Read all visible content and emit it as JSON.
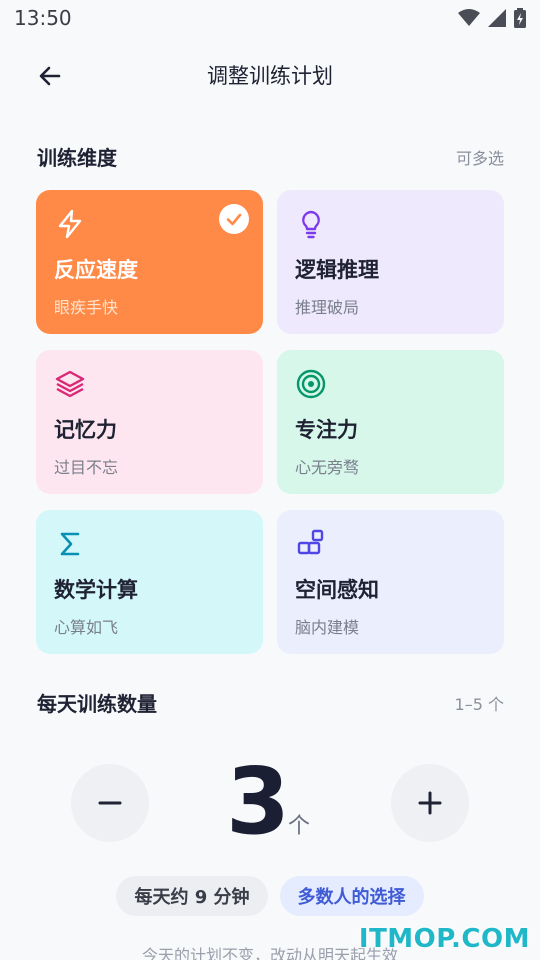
{
  "status_bar": {
    "time": "13:50"
  },
  "header": {
    "title": "调整训练计划"
  },
  "dimensions": {
    "title": "训练维度",
    "hint": "可多选",
    "items": [
      {
        "title": "反应速度",
        "subtitle": "眼疾手快",
        "icon": "lightning-icon",
        "selected": true,
        "bg": "#ff8a48",
        "accent": "#ffffff"
      },
      {
        "title": "逻辑推理",
        "subtitle": "推理破局",
        "icon": "lightbulb-icon",
        "selected": false,
        "bg": "#efe9fd",
        "accent": "#7c3aed"
      },
      {
        "title": "记忆力",
        "subtitle": "过目不忘",
        "icon": "layers-icon",
        "selected": false,
        "bg": "#fde6ef",
        "accent": "#db2777"
      },
      {
        "title": "专注力",
        "subtitle": "心无旁骛",
        "icon": "target-icon",
        "selected": false,
        "bg": "#d6f7ea",
        "accent": "#059669"
      },
      {
        "title": "数学计算",
        "subtitle": "心算如飞",
        "icon": "sigma-icon",
        "selected": false,
        "bg": "#d4f7fa",
        "accent": "#0891b2"
      },
      {
        "title": "空间感知",
        "subtitle": "脑内建模",
        "icon": "blocks-icon",
        "selected": false,
        "bg": "#ebeefd",
        "accent": "#4f46e5"
      }
    ]
  },
  "daily_count": {
    "title": "每天训练数量",
    "hint": "1–5 个",
    "value": "3",
    "unit": "个",
    "minus_label": "−",
    "plus_label": "+",
    "pills": [
      "每天约 9 分钟",
      "多数人的选择"
    ],
    "footnote": "今天的计划不变，改动从明天起生效"
  },
  "watermark": "ITMOP.COM"
}
